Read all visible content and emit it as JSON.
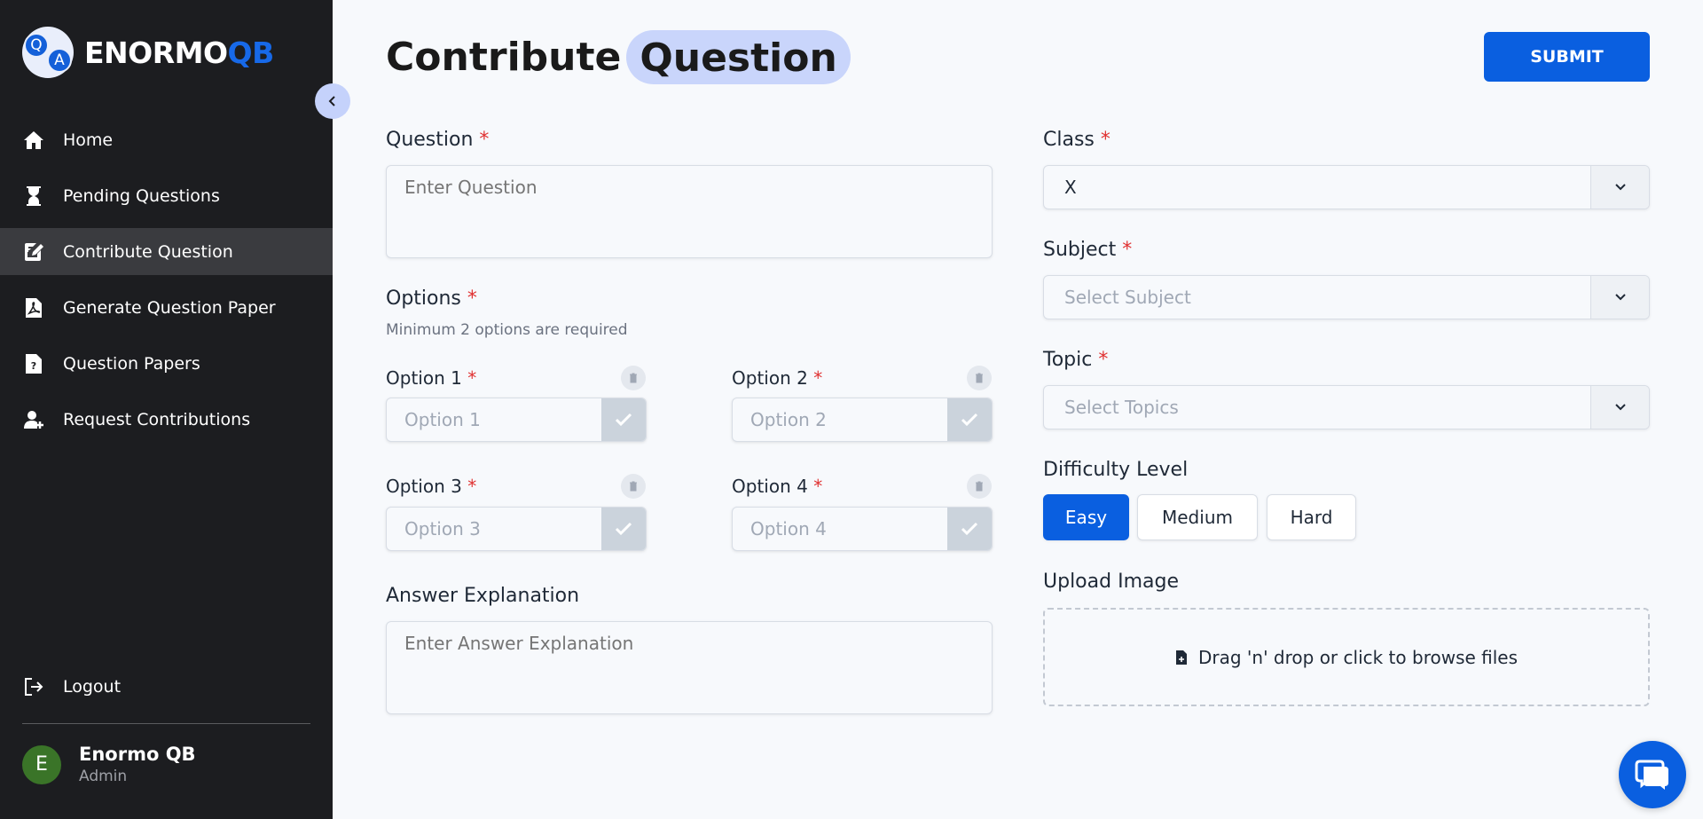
{
  "brand": {
    "name_main": "ENORMO",
    "name_accent": "QB",
    "logo_q": "Q",
    "logo_a": "A"
  },
  "sidebar": {
    "items": [
      {
        "label": "Home",
        "icon": "home-icon"
      },
      {
        "label": "Pending Questions",
        "icon": "hourglass-icon"
      },
      {
        "label": "Contribute Question",
        "icon": "edit-note-icon",
        "active": true
      },
      {
        "label": "Generate Question Paper",
        "icon": "pdf-file-icon"
      },
      {
        "label": "Question Papers",
        "icon": "question-file-icon"
      },
      {
        "label": "Request Contributions",
        "icon": "user-plus-icon"
      }
    ],
    "logout": "Logout",
    "user": {
      "initial": "E",
      "name": "Enormo QB",
      "role": "Admin"
    }
  },
  "header": {
    "title_part1": "Contribute",
    "title_part2": "Question",
    "submit_label": "SUBMIT"
  },
  "form": {
    "question": {
      "label": "Question",
      "placeholder": "Enter Question"
    },
    "options": {
      "label": "Options",
      "hint": "Minimum 2 options are required",
      "items": [
        {
          "label": "Option 1",
          "placeholder": "Option 1"
        },
        {
          "label": "Option 2",
          "placeholder": "Option 2"
        },
        {
          "label": "Option 3",
          "placeholder": "Option 3"
        },
        {
          "label": "Option 4",
          "placeholder": "Option 4"
        }
      ]
    },
    "explanation": {
      "label": "Answer Explanation",
      "placeholder": "Enter Answer Explanation"
    },
    "class": {
      "label": "Class",
      "value": "X"
    },
    "subject": {
      "label": "Subject",
      "placeholder": "Select Subject"
    },
    "topic": {
      "label": "Topic",
      "placeholder": "Select Topics"
    },
    "difficulty": {
      "label": "Difficulty Level",
      "options": [
        "Easy",
        "Medium",
        "Hard"
      ],
      "selected": "Easy"
    },
    "upload": {
      "label": "Upload Image",
      "dropzone_text": "Drag 'n' drop or click to browse files"
    }
  },
  "required_mark": "*",
  "colors": {
    "accent": "#0a5fe0",
    "sidebar_bg": "#1c1d20",
    "title_highlight": "#c9d5fb",
    "required": "#e03131"
  }
}
